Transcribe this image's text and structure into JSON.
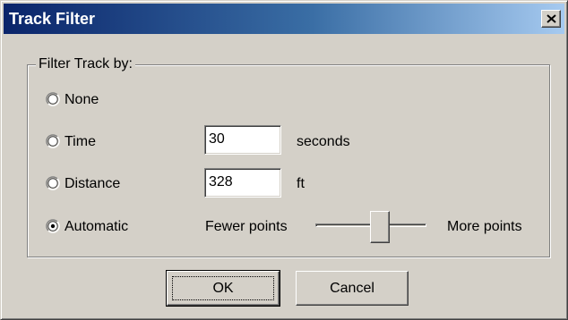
{
  "window": {
    "title": "Track Filter"
  },
  "group": {
    "label": "Filter Track by:"
  },
  "options": {
    "none": {
      "label": "None",
      "checked": false
    },
    "time": {
      "label": "Time",
      "checked": false,
      "value": "30",
      "unit": "seconds"
    },
    "distance": {
      "label": "Distance",
      "checked": false,
      "value": "328",
      "unit": "ft"
    },
    "automatic": {
      "label": "Automatic",
      "checked": true,
      "min_label": "Fewer points",
      "max_label": "More points",
      "level": 0.6
    }
  },
  "buttons": {
    "ok": "OK",
    "cancel": "Cancel"
  },
  "colors": {
    "titlebar_start": "#0a246a",
    "titlebar_end": "#a6caf0",
    "face": "#d4d0c8"
  },
  "icons": {
    "close": "close-icon"
  }
}
